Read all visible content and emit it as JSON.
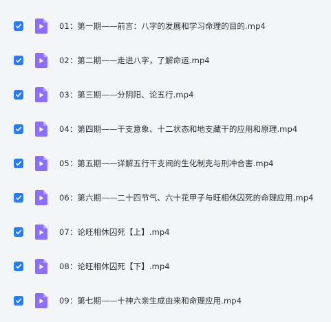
{
  "accent_color": "#2a7dee",
  "icon_color": "#8d6ff5",
  "files": [
    {
      "name": "01：第一期——前言：八字的发展和学习命理的目的.mp4",
      "checked": true,
      "icon": "video-file-icon"
    },
    {
      "name": "02：第二期——走进八字，了解命运.mp4",
      "checked": true,
      "icon": "video-file-icon"
    },
    {
      "name": "03：第三期——分阴阳、论五行.mp4",
      "checked": true,
      "icon": "video-file-icon"
    },
    {
      "name": "04：第四期——干支意象、十二状态和地支藏干的应用和原理.mp4",
      "checked": true,
      "icon": "video-file-icon"
    },
    {
      "name": "05：第五期——详解五行干支间的生化制克与刑冲合害.mp4",
      "checked": true,
      "icon": "video-file-icon"
    },
    {
      "name": "06：第六期——二十四节气、六十花甲子与旺相休囚死的命理应用.mp4",
      "checked": true,
      "icon": "video-file-icon"
    },
    {
      "name": "07：论旺相休囚死【上】.mp4",
      "checked": true,
      "icon": "video-file-icon"
    },
    {
      "name": "08：论旺相休囚死【下】.mp4",
      "checked": true,
      "icon": "video-file-icon"
    },
    {
      "name": "09：第七期——十神六亲生成由来和命理应用.mp4",
      "checked": true,
      "icon": "video-file-icon"
    }
  ]
}
